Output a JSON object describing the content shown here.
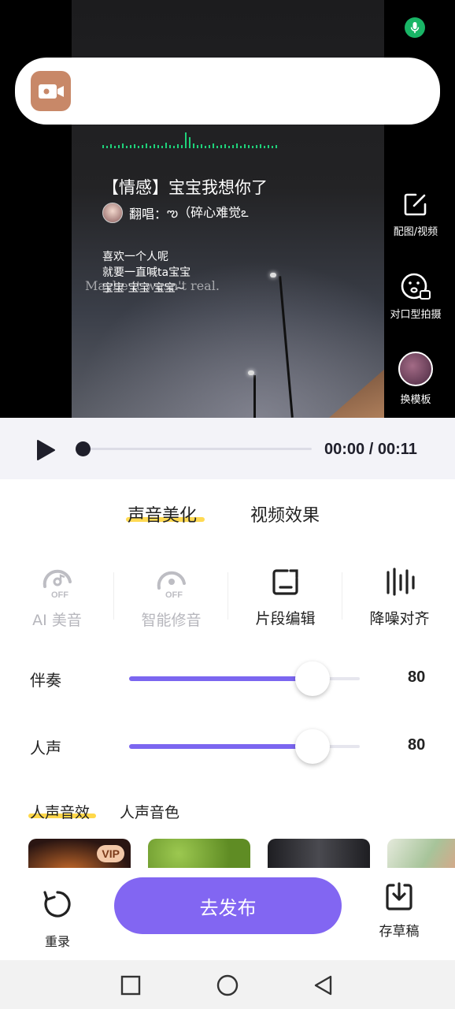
{
  "recording_bar": {
    "icon": "video-camera-icon"
  },
  "status": {
    "mic_icon": "microphone-icon"
  },
  "video": {
    "song_title": "【情感】宝宝我想你了",
    "singer_prefix": "翻唱：",
    "singer_name": "ఌ（碎心难觉ఽ",
    "lyrics": [
      "喜欢一个人呢",
      "就要一直喊ta宝宝",
      "宝宝 宝宝 宝宝~"
    ],
    "overlay_text": "Maybe it wasn't real."
  },
  "side_tools": [
    {
      "label": "配图/视频",
      "icon": "edit-square-icon"
    },
    {
      "label": "对口型拍摄",
      "icon": "face-camera-icon"
    },
    {
      "label": "换模板",
      "icon": "template-thumbnail"
    }
  ],
  "player": {
    "current": "00:00",
    "total": "00:11",
    "time_text": "00:00 / 00:11",
    "progress": 0
  },
  "tabs": [
    {
      "label": "声音美化",
      "active": true
    },
    {
      "label": "视频效果",
      "active": false
    }
  ],
  "tools": [
    {
      "label": "AI 美音",
      "icon": "ai-voice-off-icon",
      "enabled": false
    },
    {
      "label": "智能修音",
      "icon": "smart-tune-off-icon",
      "enabled": false
    },
    {
      "label": "片段编辑",
      "icon": "clip-edit-icon",
      "enabled": true
    },
    {
      "label": "降噪对齐",
      "icon": "denoise-align-icon",
      "enabled": true
    }
  ],
  "sliders": [
    {
      "label": "伴奏",
      "value": "80"
    },
    {
      "label": "人声",
      "value": "80"
    }
  ],
  "effect_tabs": [
    {
      "label": "人声音效",
      "active": true
    },
    {
      "label": "人声音色",
      "active": false
    }
  ],
  "effect_cards": [
    {
      "badge": "VIP",
      "color": "#2a1512"
    },
    {
      "badge": "",
      "color": "#6f9e2c"
    },
    {
      "badge": "",
      "color": "#2f2f33"
    },
    {
      "badge": "",
      "color": "#c9d8c0"
    }
  ],
  "actions": {
    "rerecord_label": "重录",
    "publish_label": "去发布",
    "draft_label": "存草稿"
  },
  "colors": {
    "accent": "#8266f2",
    "highlight": "#ffd84a",
    "record_icon_bg": "#c88868",
    "mic_green": "#19b566"
  }
}
